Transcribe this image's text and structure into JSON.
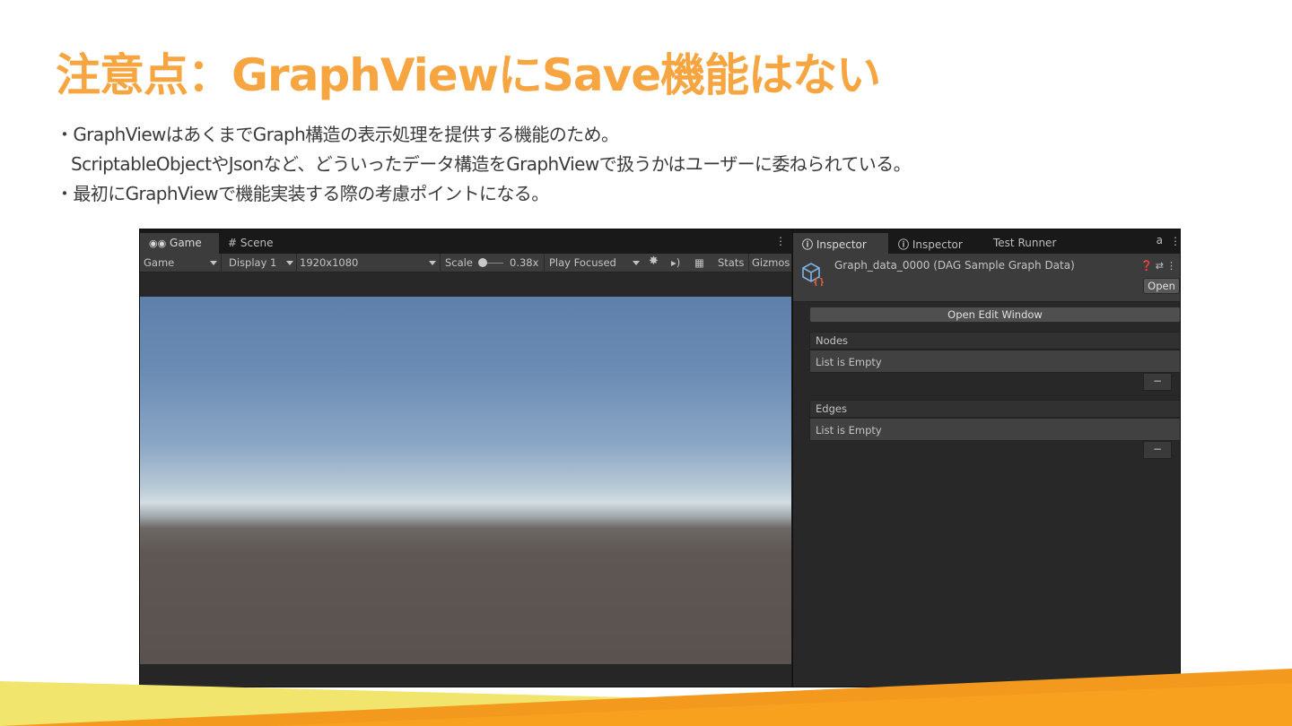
{
  "slide": {
    "title": "注意点：GraphViewにSave機能はない",
    "bullets": [
      "・GraphViewはあくまでGraph構造の表示処理を提供する機能のため。",
      "ScriptableObjectやJsonなど、どういったデータ構造をGraphViewで扱うかはユーザーに委ねられている。",
      "・最初にGraphViewで機能実装する際の考慮ポイントになる。"
    ]
  },
  "game_panel": {
    "tabs": [
      {
        "label": "Game",
        "icon": "gamepad-icon",
        "active": true
      },
      {
        "label": "Scene",
        "icon": "grid-icon",
        "active": false
      }
    ],
    "toolbar": {
      "view_select": "Game",
      "display_select": "Display 1",
      "resolution_select": "1920x1080",
      "scale_label": "Scale",
      "scale_value": "0.38x",
      "play_mode_select": "Play Focused",
      "stats_label": "Stats",
      "gizmos_label": "Gizmos"
    }
  },
  "inspector_panel": {
    "tabs": [
      {
        "label": "Inspector",
        "icon": "info-icon",
        "active": true
      },
      {
        "label": "Inspector",
        "icon": "info-icon",
        "active": false
      },
      {
        "label": "Test Runner",
        "active": false
      }
    ],
    "asset_name": "Graph_data_0000 (DAG Sample Graph Data)",
    "open_button": "Open",
    "open_edit_window_button": "Open Edit Window",
    "lists": [
      {
        "label": "Nodes",
        "empty_text": "List is Empty",
        "remove_button": "−"
      },
      {
        "label": "Edges",
        "empty_text": "List is Empty",
        "remove_button": "−"
      }
    ]
  },
  "colors": {
    "title": "#f6a540",
    "accent_yellow": "#f0e36a",
    "accent_orange": "#f39a1e",
    "unity_dark": "#282828"
  }
}
